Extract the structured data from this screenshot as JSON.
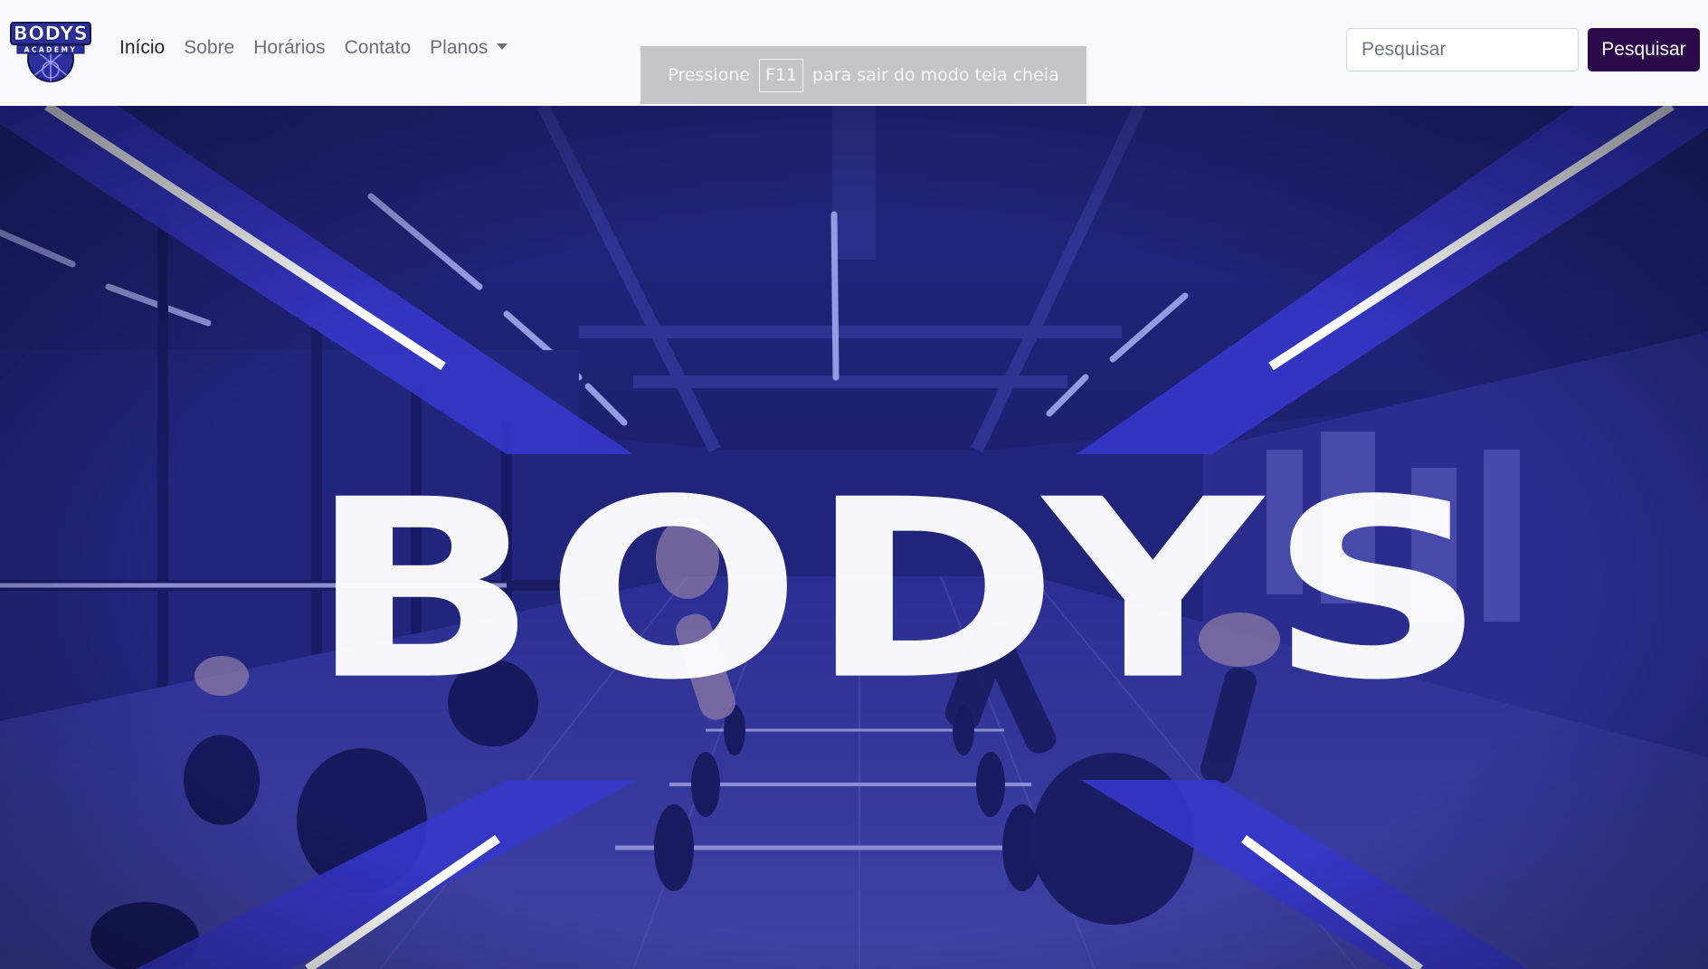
{
  "brand": {
    "logo_icon": "bodys-academy-logo",
    "logo_text_top": "BODYS",
    "logo_text_bottom": "ACADEMY"
  },
  "nav": {
    "items": [
      {
        "label": "Início",
        "active": true
      },
      {
        "label": "Sobre",
        "active": false
      },
      {
        "label": "Horários",
        "active": false
      },
      {
        "label": "Contato",
        "active": false
      }
    ],
    "dropdown": {
      "label": "Planos",
      "icon": "caret-down-icon"
    }
  },
  "search": {
    "placeholder": "Pesquisar",
    "value": "",
    "button_label": "Pesquisar"
  },
  "fullscreen_notice": {
    "before": "Pressione",
    "key": "F11",
    "after": "para sair do modo tela cheia"
  },
  "hero": {
    "title": "BODYS"
  },
  "colors": {
    "navbar_bg": "#f8f9fa",
    "button_bg": "#2a0a4a",
    "hero_overlay": "#2b2fb0",
    "active_link": "#1f2229",
    "link": "#6c6f76"
  }
}
